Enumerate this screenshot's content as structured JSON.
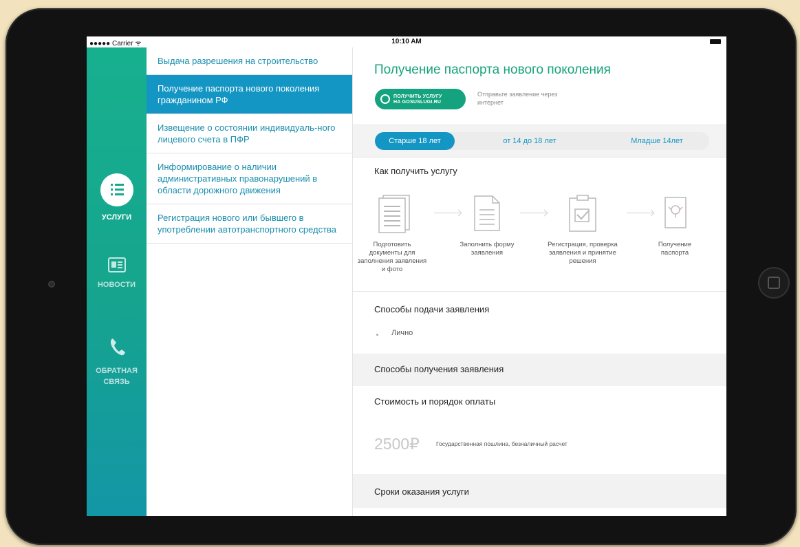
{
  "status_bar": {
    "carrier": "●●●●● Carrier ᯤ",
    "time": "10:10 AM"
  },
  "rail": {
    "items": [
      {
        "label": "УСЛУГИ",
        "icon": "list-icon"
      },
      {
        "label": "НОВОСТИ",
        "icon": "newspaper-icon"
      },
      {
        "label": "ОБРАТНАЯ СВЯЗЬ",
        "icon": "phone-icon"
      }
    ]
  },
  "services": [
    {
      "label": "Выдача разрешения на строительство"
    },
    {
      "label": "Получение паспорта нового поколения гражданином РФ",
      "active": true
    },
    {
      "label": "Извещение о состоянии индивидуаль-ного лицевого счета в ПФР"
    },
    {
      "label": "Информирование о наличии административных правонарушений в области дорожного движения"
    },
    {
      "label": "Регистрация нового или бывшего в употреблении автотранспортного средства"
    }
  ],
  "detail": {
    "title": "Получение паспорта нового поколения",
    "gosuslugi_button": {
      "line1": "ПОЛУЧИТЬ УСЛУГУ",
      "line2": "НА GOSUSLUGI.RU"
    },
    "gosuslugi_note": "Отправьте заявление через интернет",
    "tabs": [
      {
        "label": "Старше 18 лет",
        "active": true
      },
      {
        "label": "от 14 до 18 лет"
      },
      {
        "label": "Младше 14лет"
      }
    ],
    "how_to_title": "Как получить услугу",
    "steps": [
      {
        "label": "Подготовить документы для заполнения заявления и фото",
        "icon": "documents-icon"
      },
      {
        "label": "Заполнить форму заявления",
        "icon": "form-icon"
      },
      {
        "label": "Регистрация, проверка заявления и принятие решения",
        "icon": "clipboard-check-icon"
      },
      {
        "label": "Получение паспорта",
        "icon": "passport-icon"
      }
    ],
    "submit_title": "Способы подачи заявления",
    "submit_methods": [
      "Лично"
    ],
    "receive_title": "Способы получения заявления",
    "cost_title": "Стоимость и порядок оплаты",
    "price": "2500₽",
    "price_note": "Государственная пошлина, безналичный расчет",
    "terms_title": "Сроки оказания услуги"
  },
  "colors": {
    "accent_green": "#17a37b",
    "accent_blue": "#1496c4",
    "rail_top": "#17b08f",
    "rail_bottom": "#1396a6"
  }
}
